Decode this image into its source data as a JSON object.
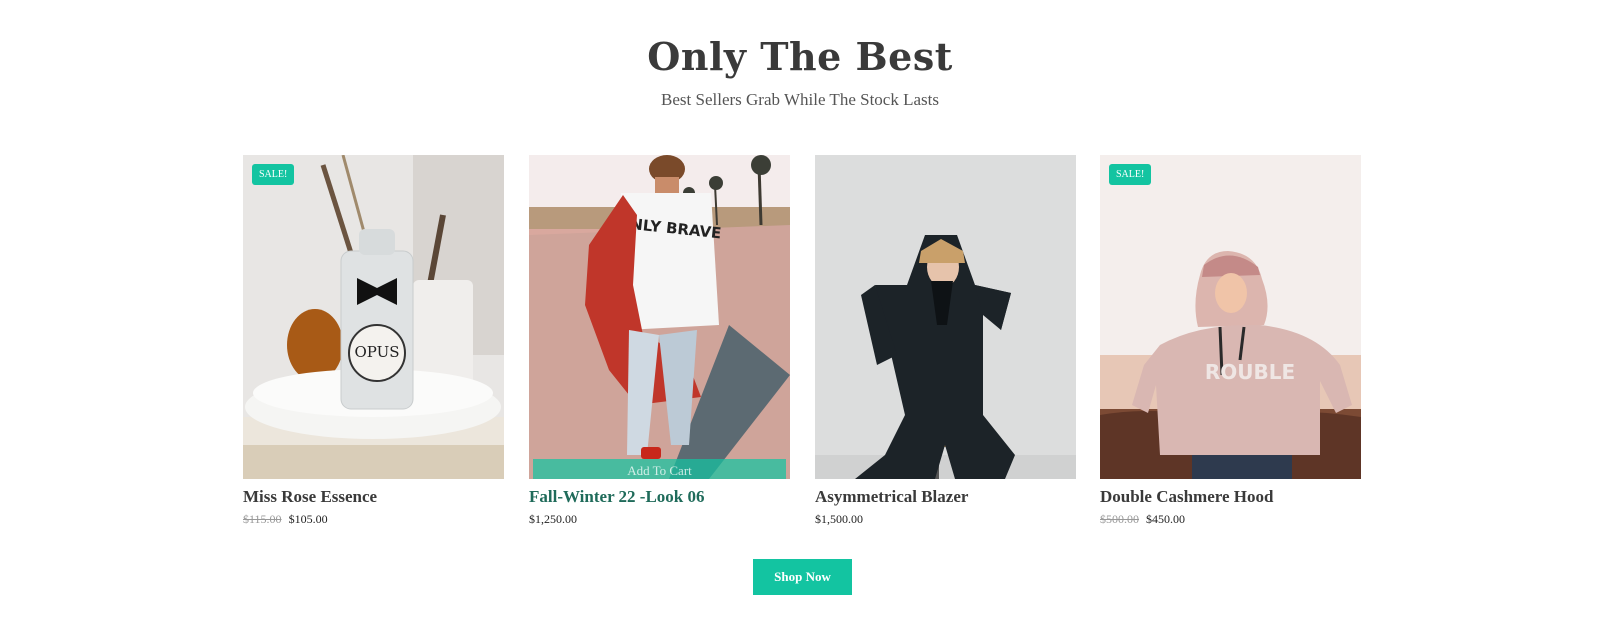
{
  "section": {
    "title": "Only The Best",
    "subtitle": "Best Sellers Grab While The Stock Lasts"
  },
  "products": [
    {
      "name": "Miss Rose Essence",
      "old_price": "$115.00",
      "price": "$105.00",
      "badge": "SALE!",
      "image": "perfume-bottle-image"
    },
    {
      "name": "Fall-Winter 22 -Look 06",
      "price": "$1,250.00",
      "cart_label": "Add To Cart",
      "image": "man-walking-image"
    },
    {
      "name": "Asymmetrical Blazer",
      "price": "$1,500.00",
      "image": "woman-blazer-image"
    },
    {
      "name": "Double Cashmere Hood",
      "old_price": "$500.00",
      "price": "$450.00",
      "badge": "SALE!",
      "image": "woman-hoodie-image"
    }
  ],
  "shop_now_label": "Shop Now",
  "colors": {
    "accent": "#13c4a1",
    "title": "#3a3a3a",
    "hover_title": "#1f6b5a"
  }
}
